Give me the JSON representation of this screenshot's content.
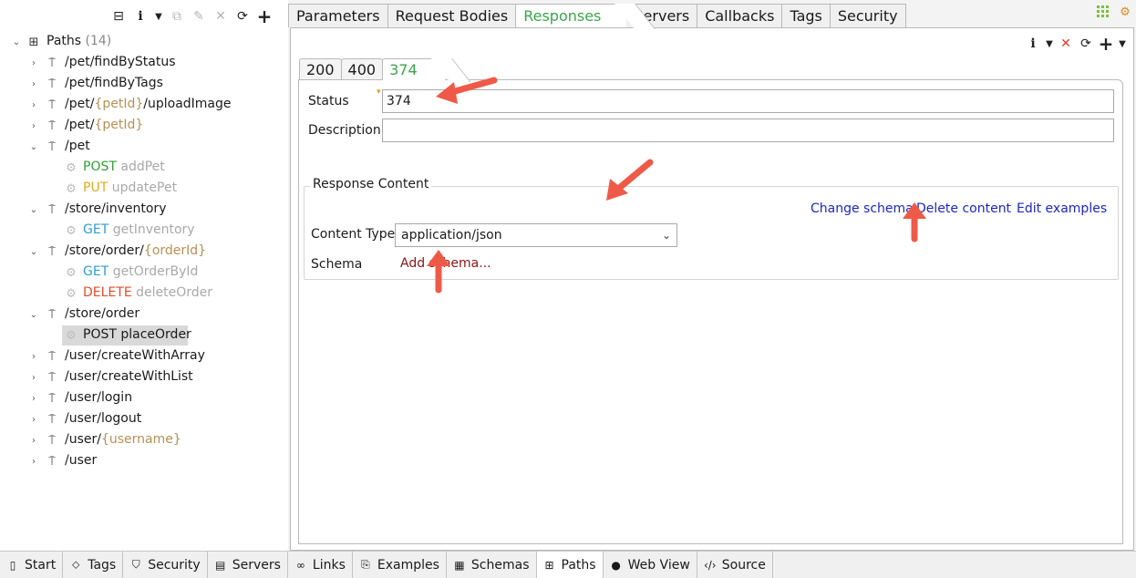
{
  "left_toolbar": {
    "icons": [
      "collapse-all-icon",
      "info-icon",
      "dropdown-caret-icon",
      "copy-icon",
      "edit-icon",
      "delete-icon",
      "refresh-icon",
      "add-icon"
    ]
  },
  "tree": {
    "root": {
      "label": "Paths",
      "count": "(14)"
    },
    "items": [
      {
        "type": "path",
        "text": "/pet/findByStatus"
      },
      {
        "type": "path",
        "text": "/pet/findByTags"
      },
      {
        "type": "path",
        "pre": "/pet/",
        "param": "{petId}",
        "post": "/uploadImage"
      },
      {
        "type": "path",
        "pre": "/pet/",
        "param": "{petId}",
        "post": ""
      },
      {
        "type": "path",
        "text": "/pet"
      },
      {
        "type": "op",
        "verb": "POST",
        "opid": "addPet"
      },
      {
        "type": "op",
        "verb": "PUT",
        "opid": "updatePet"
      },
      {
        "type": "path",
        "text": "/store/inventory"
      },
      {
        "type": "op",
        "verb": "GET",
        "opid": "getInventory"
      },
      {
        "type": "path",
        "pre": "/store/order/",
        "param": "{orderId}",
        "post": ""
      },
      {
        "type": "op",
        "verb": "GET",
        "opid": "getOrderById"
      },
      {
        "type": "op",
        "verb": "DELETE",
        "opid": "deleteOrder"
      },
      {
        "type": "path",
        "text": "/store/order"
      },
      {
        "type": "op",
        "verb": "POST",
        "opid": "placeOrder"
      },
      {
        "type": "path",
        "text": "/user/createWithArray"
      },
      {
        "type": "path",
        "text": "/user/createWithList"
      },
      {
        "type": "path",
        "text": "/user/login"
      },
      {
        "type": "path",
        "text": "/user/logout"
      },
      {
        "type": "path",
        "pre": "/user/",
        "param": "{username}",
        "post": ""
      },
      {
        "type": "path",
        "text": "/user"
      }
    ]
  },
  "main_tabs": [
    {
      "label": "Parameters"
    },
    {
      "label": "Request Bodies"
    },
    {
      "label": "Responses"
    },
    {
      "label": "Servers"
    },
    {
      "label": "Callbacks"
    },
    {
      "label": "Tags"
    },
    {
      "label": "Security"
    }
  ],
  "response_tabs": [
    "200",
    "400",
    "374"
  ],
  "response": {
    "status_label": "Status",
    "status_value": "374",
    "description_label": "Description",
    "description_value": "",
    "content_group_title": "Response Content",
    "change_schema": "Change schema",
    "delete_content": "Delete content",
    "edit_examples": "Edit examples",
    "content_type_label": "Content Type",
    "content_type_value": "application/json",
    "schema_label": "Schema",
    "add_schema": "Add schema..."
  },
  "bottom_tabs": [
    {
      "label": "Start",
      "icon": "start-icon"
    },
    {
      "label": "Tags",
      "icon": "tag-icon"
    },
    {
      "label": "Security",
      "icon": "shield-icon"
    },
    {
      "label": "Servers",
      "icon": "server-icon"
    },
    {
      "label": "Links",
      "icon": "link-icon"
    },
    {
      "label": "Examples",
      "icon": "examples-icon"
    },
    {
      "label": "Schemas",
      "icon": "schemas-icon"
    },
    {
      "label": "Paths",
      "icon": "paths-icon"
    },
    {
      "label": "Web View",
      "icon": "globe-icon"
    },
    {
      "label": "Source",
      "icon": "code-icon"
    }
  ],
  "colors": {
    "accent_green": "#3aa54a",
    "link_blue": "#1b27c8",
    "add_schema_red": "#8b1414",
    "arrow_red": "#ef5a48",
    "post": "#2fa033",
    "put": "#e2a91f",
    "get": "#2c9fd6",
    "delete": "#e74b2a",
    "param": "#b88f53"
  }
}
